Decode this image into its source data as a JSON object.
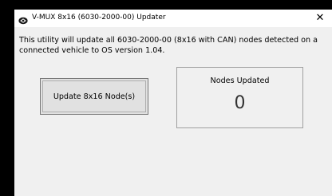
{
  "window": {
    "title": "V-MUX 8x16 (6030-2000-00) Updater",
    "close_glyph": "✕",
    "icon": "vmux-app-icon"
  },
  "description": {
    "line1": "This utility will update all 6030-2000-00 (8x16 with CAN) nodes detected on a",
    "line2": "connected vehicle to OS version 1.04."
  },
  "update_button": {
    "label": "Update 8x16 Node(s)"
  },
  "nodes_panel": {
    "label": "Nodes Updated",
    "count": "0"
  },
  "colors": {
    "window_bg": "#f0f0f0",
    "titlebar_bg": "#ffffff",
    "button_bg": "#e1e1e1",
    "panel_border": "#a0a0a0",
    "backdrop": "#000000"
  }
}
